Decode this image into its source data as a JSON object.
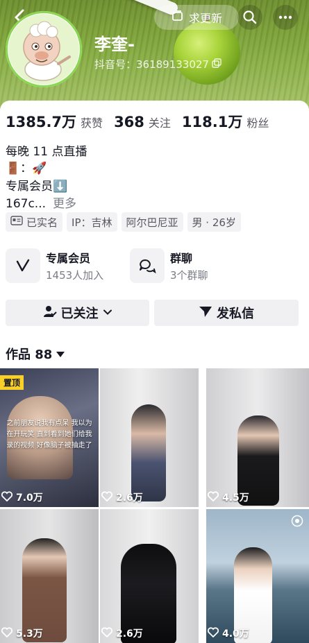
{
  "header": {
    "back_icon": "chevron-left-icon",
    "search_icon": "search-icon",
    "more_icon": "more-dots-icon",
    "update_request_label": "求更新",
    "name": "李奎-",
    "douyin_id": "抖音号：36189133027"
  },
  "stats": [
    {
      "value": "1385.7万",
      "label": "获赞"
    },
    {
      "value": "368",
      "label": "关注"
    },
    {
      "value": "118.1万",
      "label": "粉丝"
    }
  ],
  "bio": {
    "line1": "每晚 11 点直播",
    "line2": "🚪：🚀",
    "line3": "专属会员⬇️",
    "line4": "167c...",
    "more": "更多"
  },
  "tags": {
    "verified": "已实名",
    "ip": "IP：吉林",
    "location": "阿尔巴尼亚",
    "gender_age": "男 · 26岁"
  },
  "features": [
    {
      "title": "专属会员",
      "sub": "1453人加入"
    },
    {
      "title": "群聊",
      "sub": "3个群聊"
    }
  ],
  "actions": {
    "followed": "已关注",
    "message": "发私信"
  },
  "works": {
    "label": "作品 88"
  },
  "videos": [
    {
      "likes": "7.0万",
      "pinned": "置顶",
      "overlay": "之前朋友说我有点呆 我以为在开玩笑 直到看到她们给我录的视频 好像脑子被抽走了"
    },
    {
      "likes": "2.6万"
    },
    {
      "likes": "4.5万"
    },
    {
      "likes": "5.3万"
    },
    {
      "likes": "2.6万"
    },
    {
      "likes": "4.0万"
    }
  ],
  "colors": {
    "pin_badge": "#facf28",
    "text_primary": "#161823",
    "text_secondary": "#7a7c86"
  }
}
